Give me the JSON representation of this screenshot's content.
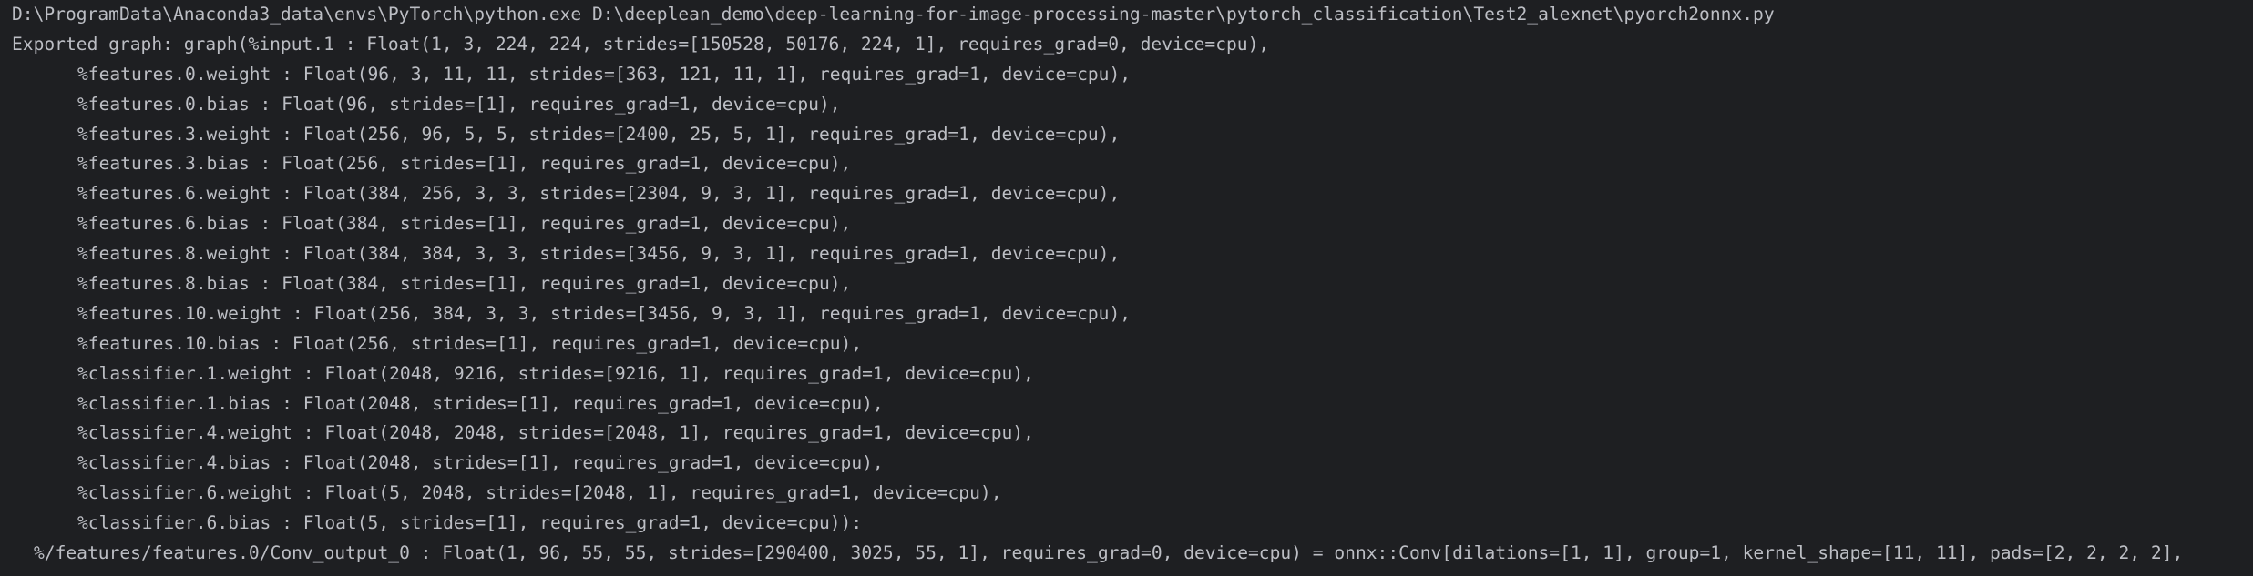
{
  "console": {
    "lines": [
      {
        "text": "D:\\ProgramData\\Anaconda3_data\\envs\\PyTorch\\python.exe D:\\deeplean_demo\\deep-learning-for-image-processing-master\\pytorch_classification\\Test2_alexnet\\pyorch2onnx.py"
      },
      {
        "text": "Exported graph: graph(%input.1 : Float(1, 3, 224, 224, strides=[150528, 50176, 224, 1], requires_grad=0, device=cpu),"
      },
      {
        "text": "%features.0.weight : Float(96, 3, 11, 11, strides=[363, 121, 11, 1], requires_grad=1, device=cpu),"
      },
      {
        "text": "%features.0.bias : Float(96, strides=[1], requires_grad=1, device=cpu),"
      },
      {
        "text": "%features.3.weight : Float(256, 96, 5, 5, strides=[2400, 25, 5, 1], requires_grad=1, device=cpu),"
      },
      {
        "text": "%features.3.bias : Float(256, strides=[1], requires_grad=1, device=cpu),"
      },
      {
        "text": "%features.6.weight : Float(384, 256, 3, 3, strides=[2304, 9, 3, 1], requires_grad=1, device=cpu),"
      },
      {
        "text": "%features.6.bias : Float(384, strides=[1], requires_grad=1, device=cpu),"
      },
      {
        "text": "%features.8.weight : Float(384, 384, 3, 3, strides=[3456, 9, 3, 1], requires_grad=1, device=cpu),"
      },
      {
        "text": "%features.8.bias : Float(384, strides=[1], requires_grad=1, device=cpu),"
      },
      {
        "text": "%features.10.weight : Float(256, 384, 3, 3, strides=[3456, 9, 3, 1], requires_grad=1, device=cpu),"
      },
      {
        "text": "%features.10.bias : Float(256, strides=[1], requires_grad=1, device=cpu),"
      },
      {
        "text": "%classifier.1.weight : Float(2048, 9216, strides=[9216, 1], requires_grad=1, device=cpu),"
      },
      {
        "text": "%classifier.1.bias : Float(2048, strides=[1], requires_grad=1, device=cpu),"
      },
      {
        "text": "%classifier.4.weight : Float(2048, 2048, strides=[2048, 1], requires_grad=1, device=cpu),"
      },
      {
        "text": "%classifier.4.bias : Float(2048, strides=[1], requires_grad=1, device=cpu),"
      },
      {
        "text": "%classifier.6.weight : Float(5, 2048, strides=[2048, 1], requires_grad=1, device=cpu),"
      },
      {
        "text": "%classifier.6.bias : Float(5, strides=[1], requires_grad=1, device=cpu)):"
      },
      {
        "text": "%/features/features.0/Conv_output_0 : Float(1, 96, 55, 55, strides=[290400, 3025, 55, 1], requires_grad=0, device=cpu) = onnx::Conv[dilations=[1, 1], group=1, kernel_shape=[11, 11], pads=[2, 2, 2, 2],"
      }
    ]
  }
}
